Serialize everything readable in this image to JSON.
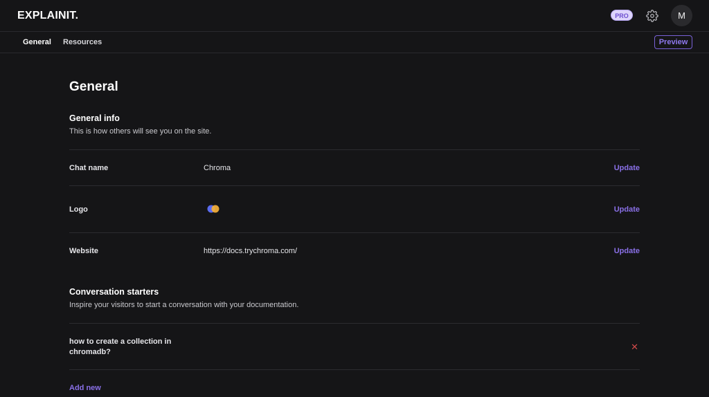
{
  "header": {
    "logo": "EXPLAINIT.",
    "badge": "PRO",
    "avatar_initial": "M",
    "icons": {
      "settings": "gear-icon"
    }
  },
  "tabs": [
    {
      "label": "General",
      "active": true
    },
    {
      "label": "Resources",
      "active": false
    }
  ],
  "preview_label": "Preview",
  "page": {
    "title": "General"
  },
  "general_info": {
    "title": "General info",
    "description": "This is how others will see you on the site.",
    "rows": [
      {
        "label": "Chat name",
        "value": "Chroma",
        "action": "Update"
      },
      {
        "label": "Logo",
        "value": "",
        "action": "Update"
      },
      {
        "label": "Website",
        "value": "https://docs.trychroma.com/",
        "action": "Update"
      }
    ]
  },
  "conversation_starters": {
    "title": "Conversation starters",
    "description": "Inspire your visitors to start a conversation with your documentation.",
    "items": [
      {
        "text": "how to create a collection in chromadb?"
      }
    ],
    "add_label": "Add new"
  },
  "colors": {
    "accent": "#8a70e8",
    "background": "#151517",
    "danger": "#d24a4a",
    "logo_left": "#5a6cf0",
    "logo_right": "#f5b03a"
  }
}
